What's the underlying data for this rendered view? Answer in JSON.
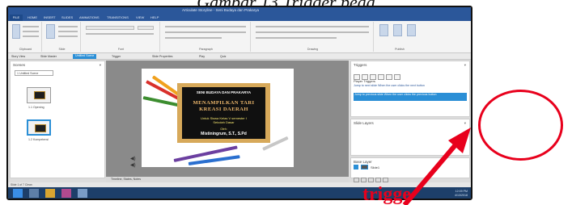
{
  "caption": "Gambar 13 Trigger peda",
  "window": {
    "title": "Articulate Storyline - Seni Budaya dan Prakarya"
  },
  "menu_tabs": [
    "FILE",
    "HOME",
    "INSERT",
    "SLIDES",
    "ANIMATIONS",
    "TRANSITIONS",
    "VIEW",
    "HELP"
  ],
  "ribbon_groups": [
    "Clipboard",
    "Slide",
    "Font",
    "Paragraph",
    "Drawing",
    "Publish"
  ],
  "command_bar": {
    "items": [
      "Story View",
      "Slide Master",
      "Untitled Scene",
      "Trigger",
      "Slide Properties",
      "Play",
      "Quiz"
    ],
    "active_index": 2
  },
  "scenes_panel": {
    "title": "Scenes",
    "dropdown": "1 Untitled Scene",
    "thumbs": [
      "1.1 Opening",
      "1.2 Kompetensi"
    ]
  },
  "slide": {
    "subject": "SENI BUDAYA DAN PRAKARYA",
    "title_line1": "MENAMPILKAN TARI",
    "title_line2": "KREASI DAERAH",
    "audience_line1": "Untuk Siswa Kelas V semester I",
    "audience_line2": "Sekolah Dasar",
    "author_label": "Oleh:",
    "author": "Mistiningrum, S.T., S.Pd"
  },
  "stage_status": "Timeline, States, Notes",
  "triggers_panel": {
    "title": "Triggers",
    "section": "Player Triggers",
    "trigger1": "Jump to next slide When the user clicks the next button",
    "trigger2": "Jump to previous slide When the user clicks the previous button"
  },
  "layers_panel": {
    "title": "Slide Layers"
  },
  "base_layer": {
    "title": "Base Layer",
    "name": "Slide1"
  },
  "status_line": "Slide 1 of 7   Clean",
  "taskbar": {
    "time": "12:09 PM",
    "date": "4/13/2018"
  },
  "annotation": {
    "label": "trigge",
    "color": "#e8001c"
  },
  "colors": {
    "accent": "#2b579a",
    "selected": "#2b8fd6"
  }
}
